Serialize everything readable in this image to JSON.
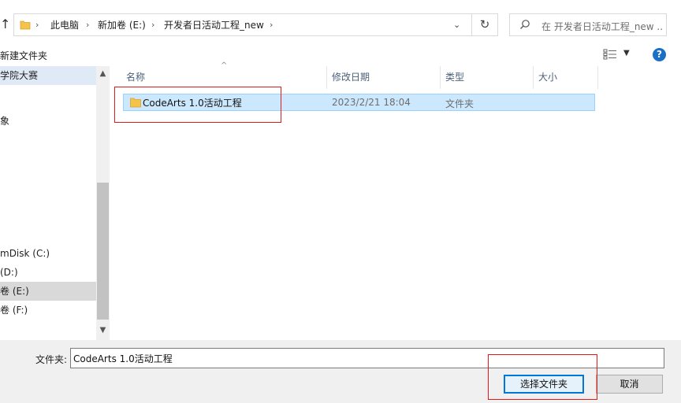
{
  "address": {
    "crumbs": [
      "此电脑",
      "新加卷 (E:)",
      "开发者日活动工程_new"
    ]
  },
  "search": {
    "placeholder": "在 开发者日活动工程_new ..."
  },
  "toolbar": {
    "new_folder_label": "新建文件夹"
  },
  "nav": {
    "items": [
      "学院大赛",
      "象",
      "mDisk (C:)",
      "(D:)",
      "卷 (E:)",
      "卷 (F:)"
    ]
  },
  "columns": {
    "name": "名称",
    "modified": "修改日期",
    "type": "类型",
    "size": "大小"
  },
  "files": [
    {
      "name": "CodeArts 1.0活动工程",
      "modified": "2023/2/21 18:04",
      "type": "文件夹",
      "size": ""
    }
  ],
  "footer": {
    "folder_label": "文件夹:",
    "folder_value": "CodeArts 1.0活动工程",
    "select_label": "选择文件夹",
    "cancel_label": "取消"
  },
  "colors": {
    "accent": "#0078d7",
    "selection": "#cce8ff",
    "annotation": "#e11b1b"
  },
  "icons": [
    "up-arrow-icon",
    "folder-icon",
    "chevron-right-icon",
    "chevron-down-icon",
    "refresh-icon",
    "search-icon",
    "view-options-icon",
    "help-icon"
  ]
}
